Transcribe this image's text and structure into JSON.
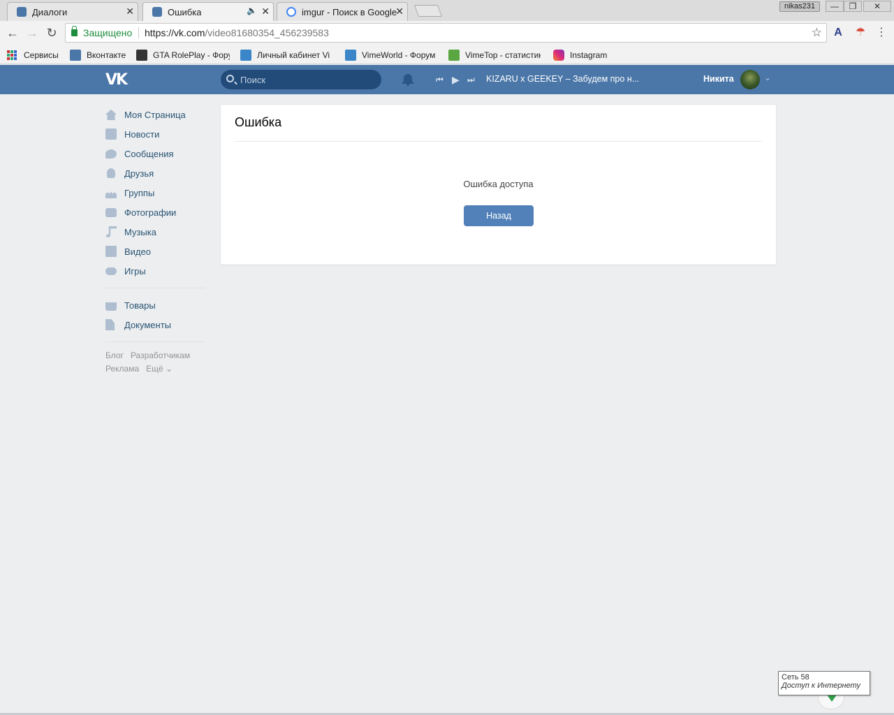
{
  "browser": {
    "tabs": [
      {
        "title": "Диалоги",
        "active": false,
        "favicon_color": "#4a76a8"
      },
      {
        "title": "Ошибка",
        "active": true,
        "favicon_color": "#4a76a8",
        "audio": true
      },
      {
        "title": "imgur - Поиск в Google",
        "active": false,
        "favicon_color": "#4285f4"
      }
    ],
    "window_user": "nikas231",
    "window_buttons": {
      "minimize": "—",
      "restore": "❐",
      "close": "✕"
    },
    "omnibox": {
      "secure_label": "Защищено",
      "url_host": "https://vk.com",
      "url_path": "/video81680354_456239583"
    },
    "nav": {
      "back": "←",
      "forward": "→",
      "reload": "↻",
      "star": "☆",
      "menu": "⋮"
    },
    "bookmarks": [
      {
        "label": "Сервисы",
        "icon": "apps-grid-icon"
      },
      {
        "label": "Вконтакте",
        "icon": "vk-icon",
        "color": "#4a76a8"
      },
      {
        "label": "GTA RolePlay - Фору",
        "icon": "gta-icon",
        "color": "#333333"
      },
      {
        "label": "Личный кабинет Vi",
        "icon": "vime-icon",
        "color": "#3a86c8"
      },
      {
        "label": "VimeWorld - Форум",
        "icon": "vime-icon",
        "color": "#3a86c8"
      },
      {
        "label": "VimeTop - статистик",
        "icon": "vimetop-icon",
        "color": "#5aa640"
      },
      {
        "label": "Instagram",
        "icon": "instagram-icon",
        "color": "#c13584"
      }
    ]
  },
  "vk": {
    "header": {
      "search_placeholder": "Поиск",
      "player": {
        "prev": "⏮",
        "play": "▶",
        "next": "⏭"
      },
      "track": "KIZARU x GEEKEY – Забудем про н...",
      "user_name": "Никита",
      "chevron": "⌄"
    },
    "menu": [
      {
        "label": "Моя Страница",
        "icon": "home"
      },
      {
        "label": "Новости",
        "icon": "news"
      },
      {
        "label": "Сообщения",
        "icon": "msg"
      },
      {
        "label": "Друзья",
        "icon": "friend"
      },
      {
        "label": "Группы",
        "icon": "groups"
      },
      {
        "label": "Фотографии",
        "icon": "photo"
      },
      {
        "label": "Музыка",
        "icon": "music"
      },
      {
        "label": "Видео",
        "icon": "video"
      },
      {
        "label": "Игры",
        "icon": "games"
      }
    ],
    "menu_extra": [
      {
        "label": "Товары",
        "icon": "market"
      },
      {
        "label": "Документы",
        "icon": "docs"
      }
    ],
    "footer_links": [
      "Блог",
      "Разработчикам",
      "Реклама",
      "Ещё ⌄"
    ],
    "content": {
      "title": "Ошибка",
      "message": "Ошибка доступа",
      "button": "Назад"
    }
  },
  "tray": {
    "tooltip_line1": "Сеть  58",
    "tooltip_line2": "Доступ к Интернету"
  },
  "colors": {
    "vk_header": "#4a76a8",
    "vk_button": "#5181b8",
    "page_bg": "#edeef0",
    "menu_link": "#285473"
  }
}
